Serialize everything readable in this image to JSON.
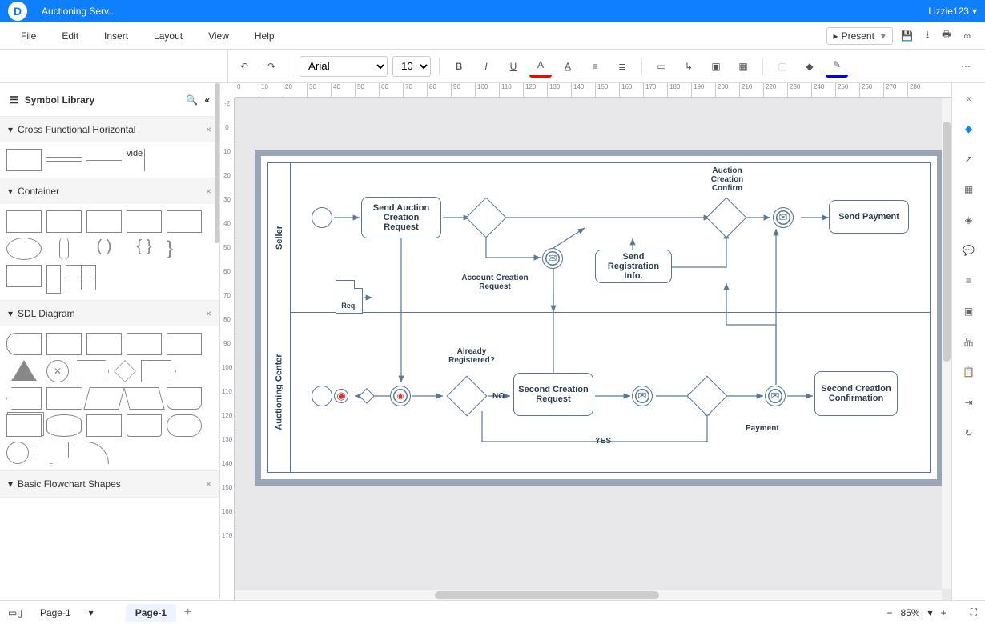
{
  "titlebar": {
    "doc_title": "Auctioning Serv...",
    "user": "Lizzie123"
  },
  "menu": {
    "file": "File",
    "edit": "Edit",
    "insert": "Insert",
    "layout": "Layout",
    "view": "View",
    "help": "Help",
    "present": "Present"
  },
  "toolbar": {
    "font": "Arial",
    "size": "10"
  },
  "left": {
    "title": "Symbol Library",
    "sections": {
      "s1": "Cross Functional Horizontal",
      "s2": "Container",
      "s3": "SDL Diagram",
      "s4": "Basic Flowchart Shapes"
    },
    "vide": "vide"
  },
  "diagram": {
    "lanes": {
      "seller": "Seller",
      "center": "Auctioning Center"
    },
    "nodes": {
      "send_auction": "Send Auction Creation Request",
      "send_reg": "Send Registration Info.",
      "send_payment": "Send Payment",
      "second_req": "Second Creation Request",
      "second_conf": "Second Creation Confirmation",
      "req_obj": "Req."
    },
    "labels": {
      "acc_req": "Account Creation Request",
      "auc_conf": "Auction Creation Confirm",
      "already": "Already Registered?",
      "payment": "Payment",
      "no": "NO",
      "yes": "YES"
    }
  },
  "status": {
    "page_tab": "Page-1",
    "page_active": "Page-1",
    "zoom": "85%"
  }
}
